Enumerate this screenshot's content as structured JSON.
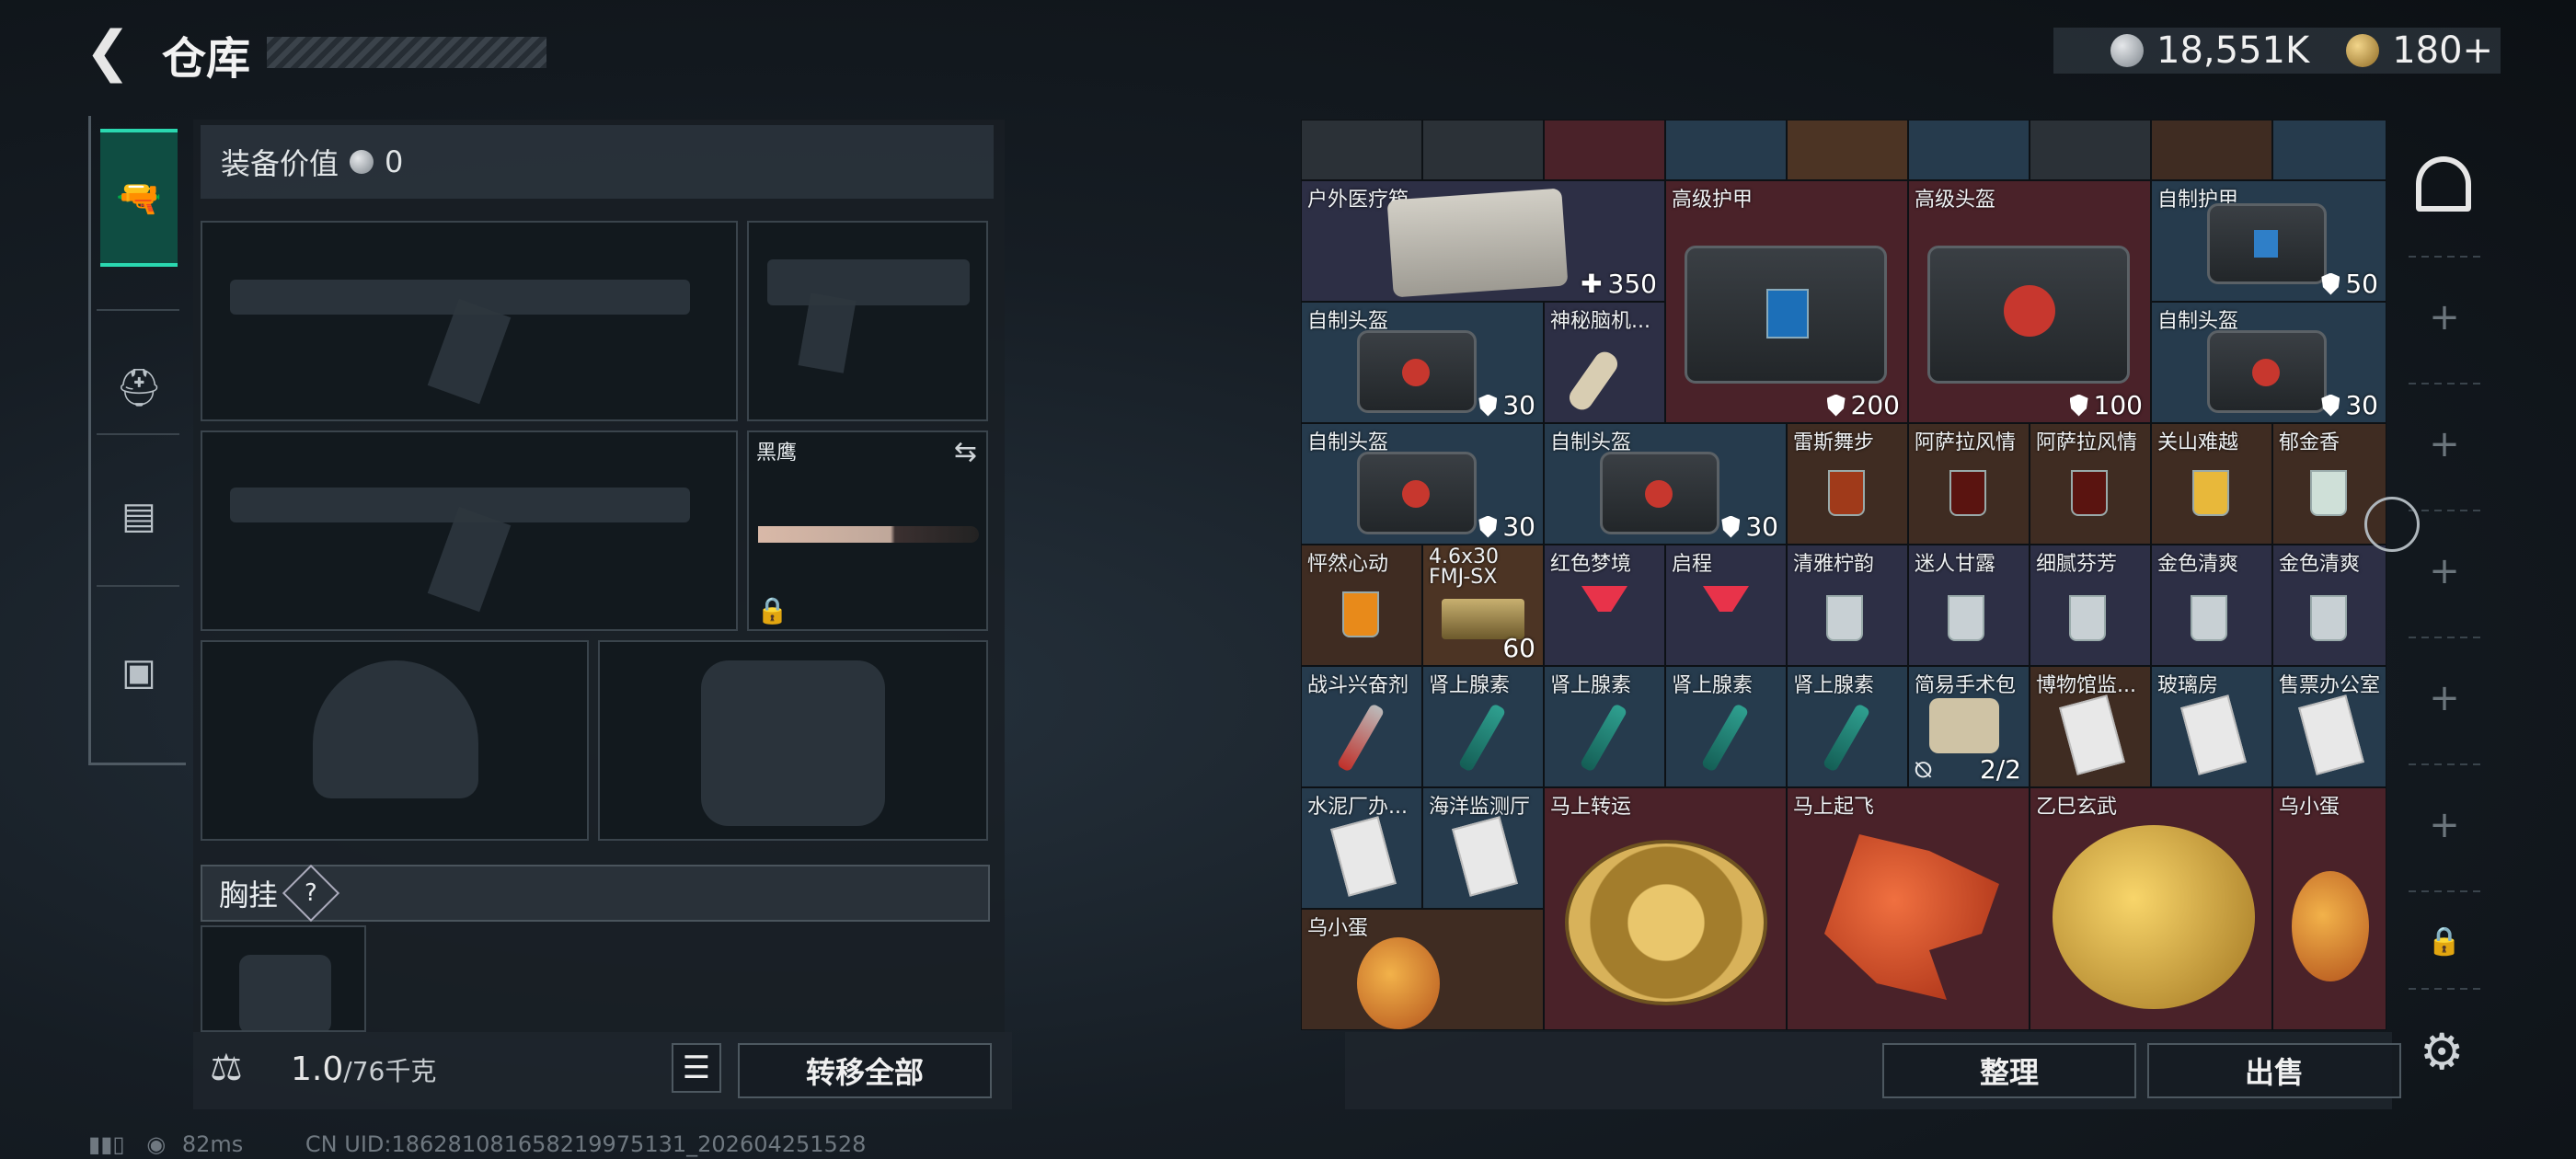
{
  "header": {
    "title": "仓库"
  },
  "currency": {
    "silver": "18,551K",
    "gold": "180+"
  },
  "equip": {
    "label": "装备价值",
    "value": "0"
  },
  "knife": {
    "name": "黑鹰"
  },
  "chest_rig": {
    "label": "胸挂",
    "help": "?"
  },
  "capacity": {
    "current": "1.0",
    "max": "/76千克"
  },
  "buttons": {
    "transfer_all": "转移全部",
    "organize": "整理",
    "sell": "出售"
  },
  "status": {
    "ping": "82ms",
    "uid": "CN UID:186281081658219975131_202604251528"
  },
  "items": [
    {
      "name": "户外医疗箱",
      "count": "350"
    },
    {
      "name": "高级护甲",
      "count": ""
    },
    {
      "name": "高级头盔",
      "count": ""
    },
    {
      "name": "自制护甲",
      "count": "50"
    },
    {
      "name": "自制头盔",
      "count": "30"
    },
    {
      "name": "神秘脑机...",
      "count": ""
    },
    {
      "name": "自制头盔",
      "count": "30"
    },
    {
      "name": "自制头盔",
      "count": "30"
    },
    {
      "name": "自制头盔",
      "count": "30"
    },
    {
      "name": "雷斯舞步",
      "count": ""
    },
    {
      "name": "阿萨拉风情",
      "count": ""
    },
    {
      "name": "阿萨拉风情",
      "count": ""
    },
    {
      "name": "关山难越",
      "count": ""
    },
    {
      "name": "郁金香",
      "count": ""
    },
    {
      "name": "怦然心动",
      "count": ""
    },
    {
      "name": "4.6x30 FMJ-SX",
      "count": "60"
    },
    {
      "name": "红色梦境",
      "count": ""
    },
    {
      "name": "启程",
      "count": ""
    },
    {
      "name": "清雅柠韵",
      "count": ""
    },
    {
      "name": "迷人甘露",
      "count": ""
    },
    {
      "name": "细腻芬芳",
      "count": ""
    },
    {
      "name": "金色清爽",
      "count": ""
    },
    {
      "name": "金色清爽",
      "count": ""
    },
    {
      "name": "战斗兴奋剂",
      "count": ""
    },
    {
      "name": "肾上腺素",
      "count": ""
    },
    {
      "name": "肾上腺素",
      "count": ""
    },
    {
      "name": "肾上腺素",
      "count": ""
    },
    {
      "name": "肾上腺素",
      "count": ""
    },
    {
      "name": "简易手术包",
      "count": "2/2"
    },
    {
      "name": "博物馆监...",
      "count": ""
    },
    {
      "name": "玻璃房",
      "count": ""
    },
    {
      "name": "售票办公室",
      "count": ""
    },
    {
      "name": "水泥厂办...",
      "count": ""
    },
    {
      "name": "海洋监测厅",
      "count": ""
    },
    {
      "name": "马上转运",
      "count": ""
    },
    {
      "name": "马上起飞",
      "count": ""
    },
    {
      "name": "乙巳玄武",
      "count": ""
    },
    {
      "name": "乌小蛋",
      "count": ""
    },
    {
      "name": "乌小蛋",
      "count": ""
    },
    {
      "name": "200"
    },
    {
      "name": "100"
    }
  ]
}
